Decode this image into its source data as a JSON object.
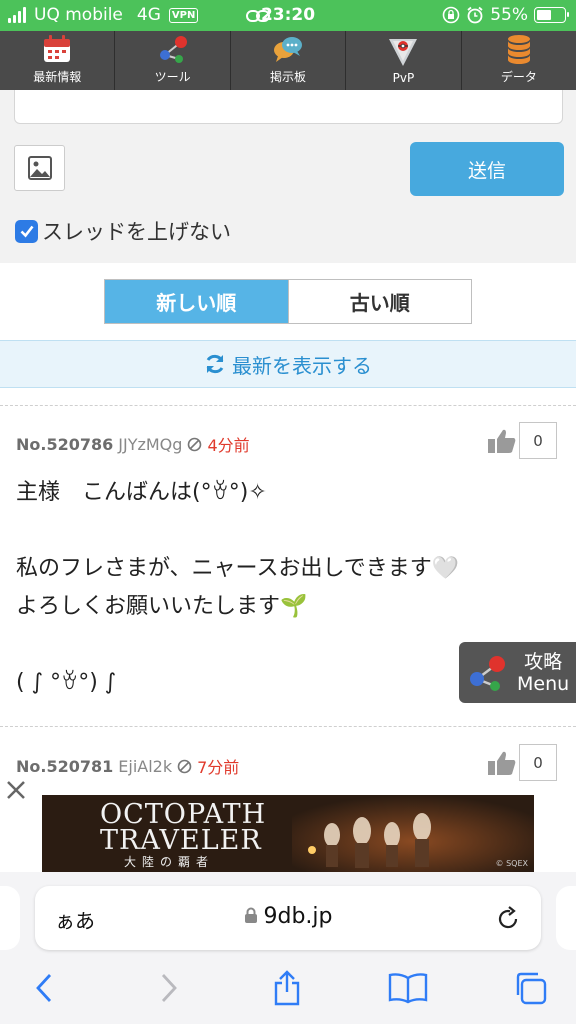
{
  "status_bar": {
    "carrier": "UQ mobile",
    "network": "4G",
    "vpn": "VPN",
    "time": "23:20",
    "battery": "55%"
  },
  "nav": {
    "items": [
      {
        "label": "最新情報",
        "icon": "calendar-icon"
      },
      {
        "label": "ツール",
        "icon": "share-nodes-icon"
      },
      {
        "label": "掲示板",
        "icon": "chat-bubbles-icon"
      },
      {
        "label": "PvP",
        "icon": "league-badge-icon"
      },
      {
        "label": "データ",
        "icon": "database-icon"
      }
    ]
  },
  "form": {
    "send_label": "送信",
    "checkbox_label": "スレッドを上げない",
    "checkbox_checked": true
  },
  "sort": {
    "newest": "新しい順",
    "oldest": "古い順"
  },
  "refresh_label": "最新を表示する",
  "posts": [
    {
      "no": "No.520786",
      "id": "JJYzMQg",
      "time": "4分前",
      "likes": "0",
      "body": "主様　こんばんは(°ꈊ°)✧\n\n私のフレさまが、ニャースお出しできます🤍\nよろしくお願いいたします🌱\n\n(   ∫ °ꈊ°) ∫"
    },
    {
      "no": "No.520781",
      "id": "EjiAl2k",
      "time": "7分前",
      "likes": "0"
    }
  ],
  "menu_button": {
    "line1": "攻略",
    "line2": "Menu"
  },
  "ad": {
    "title1": "OCTOPATH",
    "title2": "TRAVELER",
    "subtitle": "大陸の覇者",
    "copyright": "© SQEX"
  },
  "browser": {
    "aa_label": "ぁあ",
    "url": "9db.jp"
  }
}
